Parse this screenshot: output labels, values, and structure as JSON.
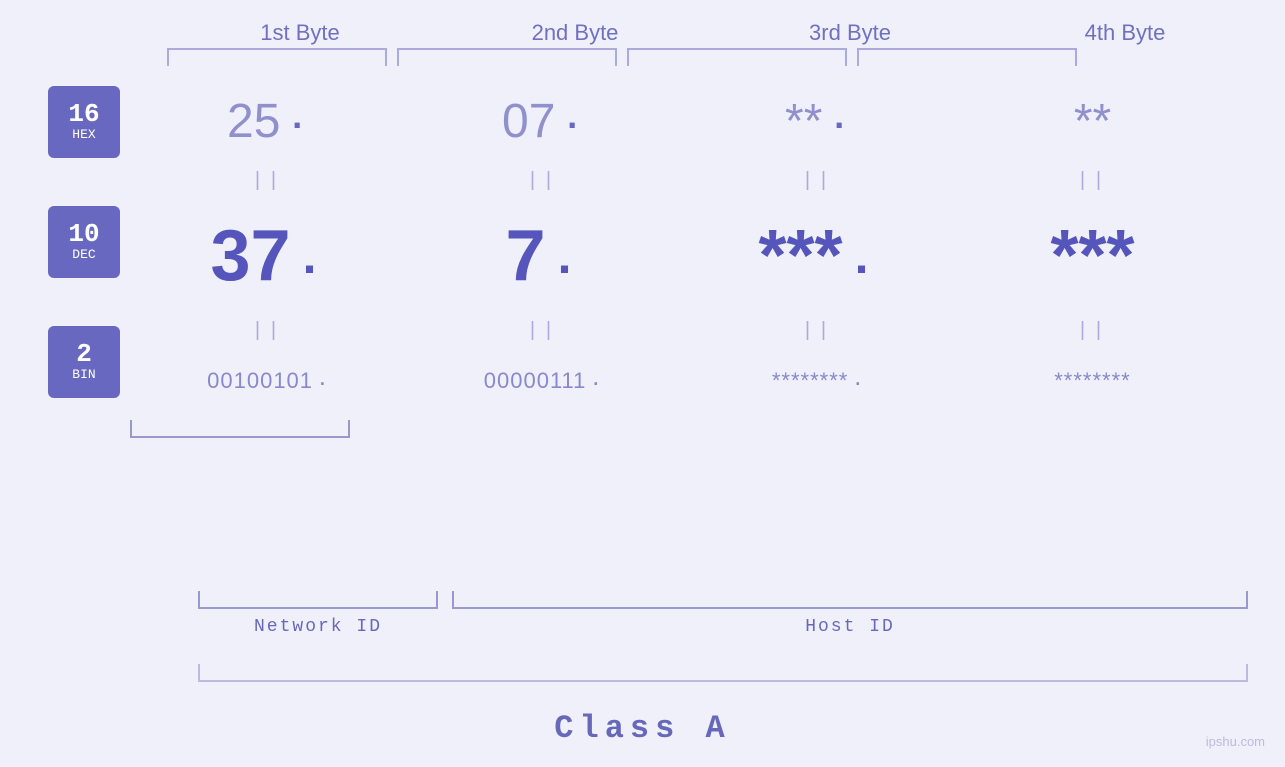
{
  "headers": {
    "byte1": "1st Byte",
    "byte2": "2nd Byte",
    "byte3": "3rd Byte",
    "byte4": "4th Byte"
  },
  "badges": {
    "hex": {
      "num": "16",
      "label": "HEX"
    },
    "dec": {
      "num": "10",
      "label": "DEC"
    },
    "bin": {
      "num": "2",
      "label": "BIN"
    }
  },
  "rows": {
    "hex": {
      "b1": "25",
      "b2": "07",
      "b3": "**",
      "b4": "**"
    },
    "dec": {
      "b1": "37",
      "b2": "7",
      "b3": "***",
      "b4": "***"
    },
    "bin": {
      "b1": "00100101",
      "b2": "00000111",
      "b3": "********",
      "b4": "********"
    }
  },
  "labels": {
    "network_id": "Network ID",
    "host_id": "Host ID",
    "class": "Class A"
  },
  "watermark": "ipshu.com"
}
